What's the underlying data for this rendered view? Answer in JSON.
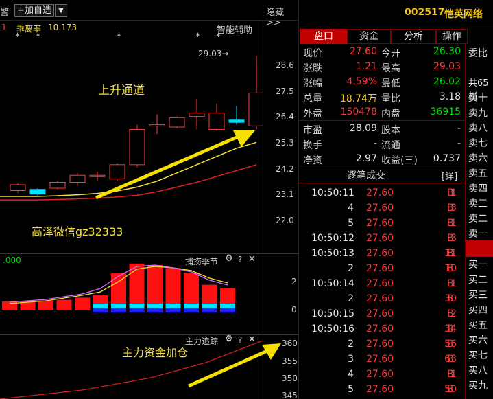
{
  "toolbar": {
    "left_label": "警",
    "add_watch": "+加自选",
    "dropdown": "▼",
    "hide": "隐藏>>"
  },
  "main_chart": {
    "indicator_name": "乖离率",
    "indicator_value": "10.173",
    "indicator_prefix": "1",
    "aux_label": "智能辅助",
    "peak_label": "29.03→",
    "annotation_channel": "上升通道",
    "annotation_watermark": "高泽微信gz32333",
    "y_ticks": [
      "28.6",
      "27.5",
      "26.4",
      "25.3",
      "24.2",
      "23.1",
      "22.0"
    ],
    "candles": [
      {
        "o": 23.3,
        "c": 23.55,
        "h": 23.6,
        "l": 23.2
      },
      {
        "o": 23.35,
        "c": 23.15,
        "h": 23.4,
        "l": 23.05
      },
      {
        "o": 23.4,
        "c": 23.65,
        "h": 23.7,
        "l": 23.35
      },
      {
        "o": 23.65,
        "c": 23.95,
        "h": 24.05,
        "l": 23.5
      },
      {
        "o": 23.95,
        "c": 23.95,
        "h": 24.1,
        "l": 23.7
      },
      {
        "o": 23.8,
        "c": 24.4,
        "h": 24.45,
        "l": 23.7
      },
      {
        "o": 24.4,
        "c": 25.9,
        "h": 26.1,
        "l": 24.3
      },
      {
        "o": 26.1,
        "c": 26.1,
        "h": 26.55,
        "l": 25.7
      },
      {
        "o": 26.0,
        "c": 26.4,
        "h": 26.45,
        "l": 25.95
      },
      {
        "o": 26.45,
        "c": 26.6,
        "h": 27.2,
        "l": 25.9
      },
      {
        "o": 25.9,
        "c": 26.6,
        "h": 27.0,
        "l": 25.85
      },
      {
        "o": 26.3,
        "c": 26.2,
        "h": 26.9,
        "l": 26.1
      },
      {
        "o": 26.05,
        "c": 27.45,
        "h": 29.03,
        "l": 25.9
      }
    ],
    "ma_yellow": [
      23.05,
      23.05,
      23.08,
      23.12,
      23.18,
      23.28,
      23.45,
      23.7,
      24.05,
      24.4,
      24.75,
      25.1,
      25.35
    ],
    "ma_red": [
      22.9,
      22.9,
      22.92,
      22.95,
      22.98,
      23.03,
      23.1,
      23.25,
      23.45,
      23.65,
      23.9,
      24.15,
      24.4
    ]
  },
  "macd_panel": {
    "title": "捕捞季节",
    "y_ticks": [
      "2",
      "0"
    ],
    "value_label": ".000",
    "bars": [
      0.6,
      0.6,
      0.65,
      0.7,
      0.85,
      1.0,
      2.5,
      3.1,
      3.0,
      2.8,
      2.5,
      1.7,
      1.5
    ]
  },
  "flow_panel": {
    "title": "主力追踪",
    "annotation": "主力资金加仓",
    "y_ticks": [
      "360",
      "355",
      "350",
      "345"
    ]
  },
  "quote": {
    "code": "002517",
    "name": "恺英网络",
    "tabs": [
      "盘口",
      "资金",
      "分析",
      "操作"
    ],
    "rows": [
      {
        "l1": "现价",
        "v1": "27.60",
        "c1": "red",
        "l2": "今开",
        "v2": "26.30",
        "c2": "green"
      },
      {
        "l1": "涨跌",
        "v1": "1.21",
        "c1": "red",
        "l2": "最高",
        "v2": "29.03",
        "c2": "red"
      },
      {
        "l1": "涨幅",
        "v1": "4.59%",
        "c1": "red",
        "l2": "最低",
        "v2": "26.02",
        "c2": "green"
      },
      {
        "l1": "总量",
        "v1": "18.74万",
        "c1": "yellow",
        "l2": "量比",
        "v2": "3.18",
        "c2": "white"
      },
      {
        "l1": "外盘",
        "v1": "150478",
        "c1": "red",
        "l2": "内盘",
        "v2": "36915",
        "c2": "green"
      },
      {
        "l1": "市盈",
        "v1": "28.09",
        "c1": "white",
        "l2": "股本",
        "v2": "-",
        "c2": "white"
      },
      {
        "l1": "换手",
        "v1": "-",
        "c1": "white",
        "l2": "流通",
        "v2": "-",
        "c2": "white"
      },
      {
        "l1": "净资",
        "v1": "2.97",
        "c1": "white",
        "l2": "收益(三)",
        "v2": "0.737",
        "c2": "white"
      }
    ],
    "ticks_title": "逐笔成交",
    "ticks_detail": "[详]",
    "ticks": [
      {
        "t": "10:50:11",
        "p": "27.60",
        "v": "1",
        "s": "B"
      },
      {
        "t": "4",
        "p": "27.60",
        "v": "3",
        "s": "B"
      },
      {
        "t": "5",
        "p": "27.60",
        "v": "1",
        "s": "B"
      },
      {
        "t": "10:50:12",
        "p": "27.60",
        "v": "3",
        "s": "B"
      },
      {
        "t": "10:50:13",
        "p": "27.60",
        "v": "11",
        "s": "B"
      },
      {
        "t": "2",
        "p": "27.60",
        "v": "10",
        "s": "B"
      },
      {
        "t": "10:50:14",
        "p": "27.60",
        "v": "1",
        "s": "B"
      },
      {
        "t": "2",
        "p": "27.60",
        "v": "30",
        "s": "B"
      },
      {
        "t": "10:50:15",
        "p": "27.60",
        "v": "2",
        "s": "B"
      },
      {
        "t": "10:50:16",
        "p": "27.60",
        "v": "34",
        "s": "B"
      },
      {
        "t": "2",
        "p": "27.60",
        "v": "56",
        "s": "B"
      },
      {
        "t": "3",
        "p": "27.60",
        "v": "63",
        "s": "B"
      },
      {
        "t": "4",
        "p": "27.60",
        "v": "1",
        "s": "B"
      },
      {
        "t": "5",
        "p": "27.60",
        "v": "50",
        "s": "B"
      }
    ]
  },
  "orderbook": {
    "header": "委比",
    "side_label": "共65档",
    "sells": [
      "卖十",
      "卖九",
      "卖八",
      "卖七",
      "卖六",
      "卖五",
      "卖四",
      "卖三",
      "卖二",
      "卖一"
    ],
    "buys": [
      "买一",
      "买二",
      "买三",
      "买四",
      "买五",
      "买六",
      "买七",
      "买八",
      "买九"
    ]
  },
  "colors": {
    "up": "#ff3b3b",
    "down": "#00e0ff",
    "ma_yellow": "#f5e03a",
    "ma_red": "#e02020",
    "arrow": "#f5e000",
    "grid": "#800000"
  }
}
